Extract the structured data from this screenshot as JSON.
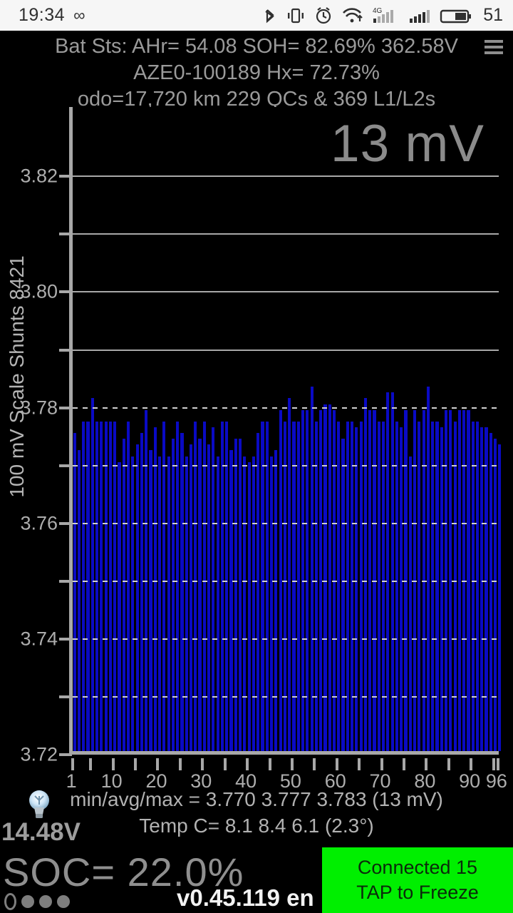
{
  "status_bar": {
    "clock": "19:34",
    "infinity": "∞",
    "battery_percent": "51",
    "icons": [
      "bluetooth-icon",
      "vibrate-icon",
      "alarm-icon",
      "wifi-icon",
      "signal-4g-icon",
      "signal-icon",
      "battery-icon"
    ],
    "network_label": "4G"
  },
  "header": {
    "line1": "Bat Sts: AHr= 54.08 SOH= 82.69% 362.58V",
    "line2": "AZE0-100189   Hx= 72.73%",
    "line3": "odo=17,720 km 229 QCs & 369 L1/L2s",
    "menu": "menu-icon"
  },
  "chart_data": {
    "type": "bar",
    "title": "13 mV",
    "ylabel": "100 mV Scale  Shunts 8421",
    "xlabel": "",
    "ylim": [
      3.72,
      3.832
    ],
    "ytick_labels": [
      "3.72",
      "3.74",
      "3.76",
      "3.78",
      "3.80",
      "3.82"
    ],
    "ytick_values": [
      3.72,
      3.74,
      3.76,
      3.78,
      3.8,
      3.82
    ],
    "minor_gridlines": [
      3.73,
      3.75,
      3.77,
      3.79,
      3.81
    ],
    "grid": true,
    "legend": "none",
    "bar_color": "#0a0ac4",
    "xtick_labels": [
      "1",
      "10",
      "20",
      "30",
      "40",
      "50",
      "60",
      "70",
      "80",
      "90",
      "96"
    ],
    "xtick_values": [
      1,
      10,
      20,
      30,
      40,
      50,
      60,
      70,
      80,
      90,
      96
    ],
    "categories": [
      1,
      2,
      3,
      4,
      5,
      6,
      7,
      8,
      9,
      10,
      11,
      12,
      13,
      14,
      15,
      16,
      17,
      18,
      19,
      20,
      21,
      22,
      23,
      24,
      25,
      26,
      27,
      28,
      29,
      30,
      31,
      32,
      33,
      34,
      35,
      36,
      37,
      38,
      39,
      40,
      41,
      42,
      43,
      44,
      45,
      46,
      47,
      48,
      49,
      50,
      51,
      52,
      53,
      54,
      55,
      56,
      57,
      58,
      59,
      60,
      61,
      62,
      63,
      64,
      65,
      66,
      67,
      68,
      69,
      70,
      71,
      72,
      73,
      74,
      75,
      76,
      77,
      78,
      79,
      80,
      81,
      82,
      83,
      84,
      85,
      86,
      87,
      88,
      89,
      90,
      91,
      92,
      93,
      94,
      95,
      96
    ],
    "values": [
      3.775,
      3.772,
      3.777,
      3.777,
      3.781,
      3.777,
      3.777,
      3.777,
      3.777,
      3.777,
      3.77,
      3.774,
      3.777,
      3.771,
      3.773,
      3.775,
      3.779,
      3.772,
      3.776,
      3.771,
      3.777,
      3.771,
      3.774,
      3.777,
      3.775,
      3.771,
      3.773,
      3.777,
      3.774,
      3.777,
      3.773,
      3.776,
      3.771,
      3.777,
      3.777,
      3.772,
      3.774,
      3.774,
      3.771,
      3.77,
      3.771,
      3.775,
      3.777,
      3.777,
      3.771,
      3.772,
      3.779,
      3.777,
      3.781,
      3.777,
      3.777,
      3.779,
      3.779,
      3.783,
      3.777,
      3.779,
      3.78,
      3.78,
      3.779,
      3.777,
      3.774,
      3.777,
      3.777,
      3.776,
      3.777,
      3.781,
      3.779,
      3.779,
      3.777,
      3.777,
      3.782,
      3.782,
      3.777,
      3.776,
      3.779,
      3.771,
      3.779,
      3.777,
      3.779,
      3.783,
      3.777,
      3.777,
      3.776,
      3.779,
      3.779,
      3.777,
      3.779,
      3.779,
      3.779,
      3.777,
      3.777,
      3.776,
      3.776,
      3.775,
      3.774,
      3.773
    ]
  },
  "footer_stats": {
    "minavgmax": "min/avg/max = 3.770 3.777 3.783  (13 mV)",
    "temp": "Temp C= 8.1  8.4  6.1  (2.3°)",
    "bulb": "lightbulb-icon",
    "volts": "14.48V"
  },
  "bottom_bar": {
    "soc": "SOC= 22.0%",
    "version": "v0.45.119 en",
    "connected": "Connected 15",
    "tap": "TAP to Freeze",
    "connected_color": "#00ef00"
  }
}
